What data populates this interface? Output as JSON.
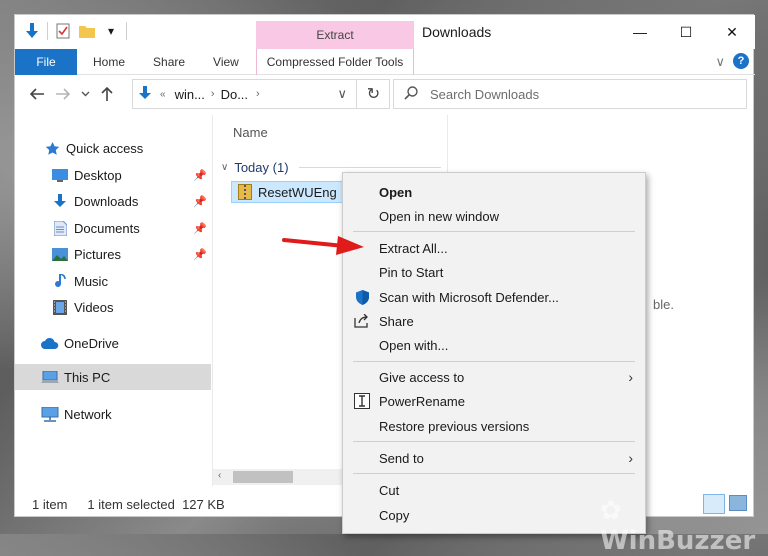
{
  "window": {
    "title": "Downloads",
    "controls": {
      "minimize": "—",
      "maximize": "☐",
      "close": "✕"
    }
  },
  "quick_access_toolbar": {
    "customize_glyph": "▾"
  },
  "context_tab_group": {
    "header": "Extract",
    "tab": "Compressed Folder Tools"
  },
  "ribbon": {
    "tabs": [
      "File",
      "Home",
      "Share",
      "View"
    ],
    "expand_glyph": "∨",
    "help_glyph": "?"
  },
  "address_bar": {
    "crumbs": [
      "«",
      "win...",
      "Do..."
    ],
    "dropdown_glyph": "∨",
    "refresh_glyph": "↻"
  },
  "search": {
    "placeholder": "Search Downloads"
  },
  "nav_pane": {
    "items": [
      {
        "label": "Quick access",
        "icon": "star-icon",
        "pinned": false
      },
      {
        "label": "Desktop",
        "icon": "desktop-icon",
        "pinned": true
      },
      {
        "label": "Downloads",
        "icon": "download-icon",
        "pinned": true
      },
      {
        "label": "Documents",
        "icon": "documents-icon",
        "pinned": true
      },
      {
        "label": "Pictures",
        "icon": "pictures-icon",
        "pinned": true
      },
      {
        "label": "Music",
        "icon": "music-icon",
        "pinned": false
      },
      {
        "label": "Videos",
        "icon": "videos-icon",
        "pinned": false
      },
      {
        "label": "OneDrive",
        "icon": "cloud-icon",
        "pinned": false
      },
      {
        "label": "This PC",
        "icon": "pc-icon",
        "pinned": false,
        "selected": true
      },
      {
        "label": "Network",
        "icon": "network-icon",
        "pinned": false
      }
    ]
  },
  "content": {
    "column_header": "Name",
    "group_label": "Today (1)",
    "file_name": "ResetWUEng",
    "detail_pane_text": "ble."
  },
  "status_bar": {
    "item_count": "1 item",
    "selection": "1 item selected  127 KB"
  },
  "context_menu": {
    "items": [
      {
        "label": "Open",
        "bold": true
      },
      {
        "label": "Open in new window"
      },
      {
        "separator": true
      },
      {
        "label": "Extract All..."
      },
      {
        "label": "Pin to Start"
      },
      {
        "label": "Scan with Microsoft Defender...",
        "icon": "defender-shield-icon"
      },
      {
        "label": "Share",
        "icon": "share-icon"
      },
      {
        "label": "Open with..."
      },
      {
        "separator": true
      },
      {
        "label": "Give access to",
        "submenu": true
      },
      {
        "label": "PowerRename",
        "icon": "powerrename-icon"
      },
      {
        "label": "Restore previous versions"
      },
      {
        "separator": true
      },
      {
        "label": "Send to",
        "submenu": true
      },
      {
        "separator": true
      },
      {
        "label": "Cut"
      },
      {
        "label": "Copy"
      }
    ]
  },
  "colors": {
    "accent": "#1a73c7",
    "context_tab": "#f8c8e4",
    "selection": "#cce8ff",
    "arrow": "#e01b1b"
  }
}
